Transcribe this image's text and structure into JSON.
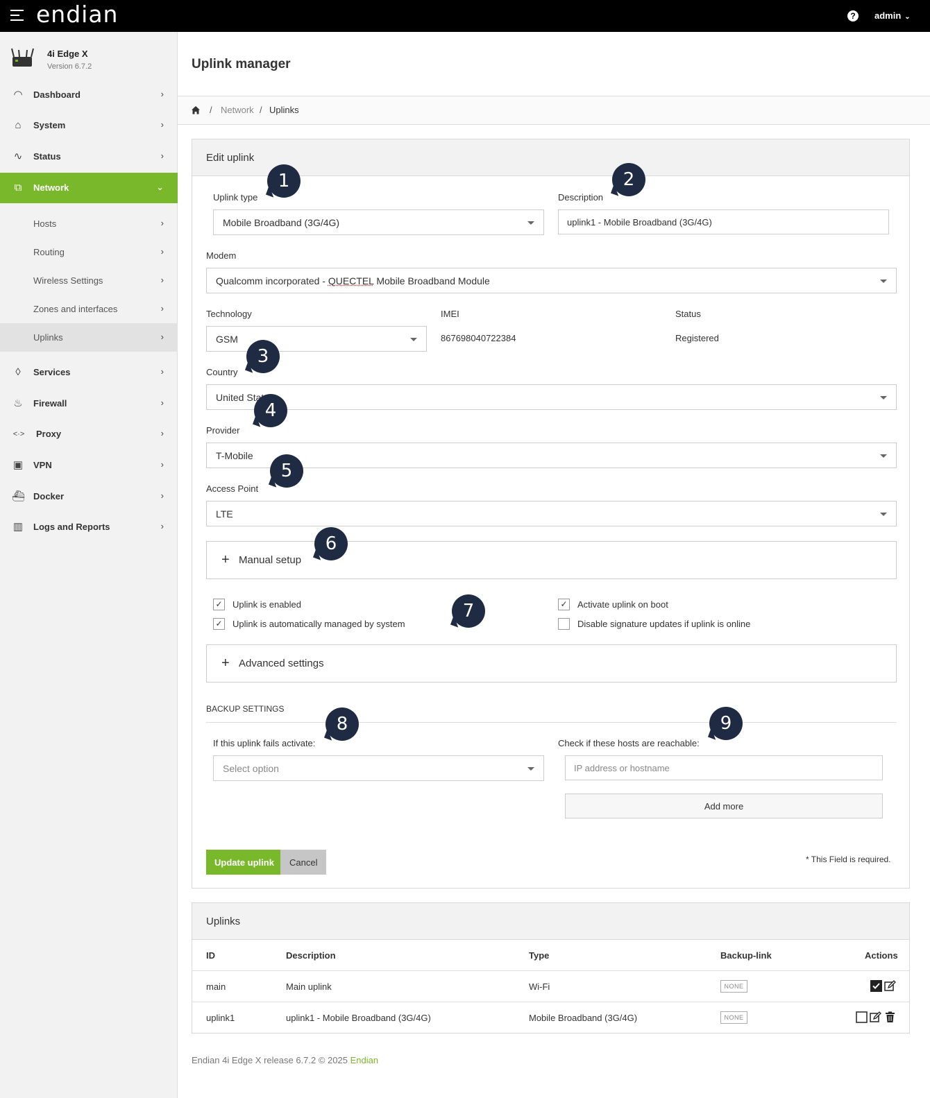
{
  "topbar": {
    "brand": "endian",
    "help": "?",
    "user": "admin",
    "user_caret": "⌄"
  },
  "sidebar": {
    "device_name": "4i Edge X",
    "device_version": "Version 6.7.2",
    "items": [
      {
        "label": "Dashboard",
        "icon": "gauge-icon"
      },
      {
        "label": "System",
        "icon": "home-icon"
      },
      {
        "label": "Status",
        "icon": "pulse-icon"
      },
      {
        "label": "Network",
        "icon": "network-icon"
      },
      {
        "label": "Services",
        "icon": "drop-icon"
      },
      {
        "label": "Firewall",
        "icon": "flame-icon"
      },
      {
        "label": "Proxy",
        "icon": "proxy-arrows-icon"
      },
      {
        "label": "VPN",
        "icon": "lock-icon"
      },
      {
        "label": "Docker",
        "icon": "docker-icon"
      },
      {
        "label": "Logs and Reports",
        "icon": "chart-icon"
      }
    ],
    "network_sub": [
      {
        "label": "Hosts"
      },
      {
        "label": "Routing"
      },
      {
        "label": "Wireless Settings"
      },
      {
        "label": "Zones and interfaces"
      },
      {
        "label": "Uplinks"
      }
    ],
    "chevron_right": "›",
    "chevron_down": "⌄"
  },
  "page": {
    "title": "Uplink manager"
  },
  "breadcrumb": {
    "sep": "/",
    "network": "Network",
    "current": "Uplinks"
  },
  "edit": {
    "title": "Edit uplink",
    "uplink_type_label": "Uplink type",
    "uplink_type_value": "Mobile Broadband (3G/4G)",
    "description_label": "Description",
    "description_value": "uplink1 - Mobile Broadband (3G/4G)",
    "modem_label": "Modem",
    "modem_value_prefix": "Qualcomm incorporated - ",
    "modem_value_brand": "QUECTEL",
    "modem_value_suffix": " Mobile Broadband Module",
    "technology_label": "Technology",
    "technology_value": "GSM",
    "imei_label": "IMEI",
    "imei_value": "867698040722384",
    "status_label": "Status",
    "status_value": "Registered",
    "country_label": "Country",
    "country_value": "United States",
    "provider_label": "Provider",
    "provider_value": "T-Mobile",
    "apn_label": "Access Point",
    "apn_value": "LTE",
    "manual_setup": "Manual setup",
    "plus": "+",
    "checkboxes": [
      {
        "label": "Uplink is enabled",
        "checked": true
      },
      {
        "label": "Uplink is automatically managed by system",
        "checked": true
      },
      {
        "label": "Activate uplink on boot",
        "checked": true
      },
      {
        "label": "Disable signature updates if uplink is online",
        "checked": false
      }
    ],
    "check_mark": "✓",
    "advanced_settings": "Advanced settings",
    "backup_title": "BACKUP SETTINGS",
    "fails_label": "If this uplink fails activate:",
    "fails_placeholder": "Select option",
    "hosts_label": "Check if these hosts are reachable:",
    "hosts_placeholder": "IP address or hostname",
    "add_more": "Add more",
    "update_button": "Update uplink",
    "cancel_button": "Cancel",
    "required_note": "* This Field is required."
  },
  "callouts": [
    "1",
    "2",
    "3",
    "4",
    "5",
    "6",
    "7",
    "8",
    "9"
  ],
  "uplinks": {
    "title": "Uplinks",
    "columns": [
      "ID",
      "Description",
      "Type",
      "Backup-link",
      "Actions"
    ],
    "rows": [
      {
        "id": "main",
        "description": "Main uplink",
        "type": "Wi-Fi",
        "backup": "NONE"
      },
      {
        "id": "uplink1",
        "description": "uplink1 - Mobile Broadband (3G/4G)",
        "type": "Mobile Broadband (3G/4G)",
        "backup": "NONE"
      }
    ]
  },
  "footer": {
    "text": "Endian 4i Edge X release 6.7.2 © 2025 ",
    "link": "Endian"
  },
  "colors": {
    "accent": "#7ab82b",
    "callout": "#1e2b42",
    "topbar": "#000000"
  }
}
